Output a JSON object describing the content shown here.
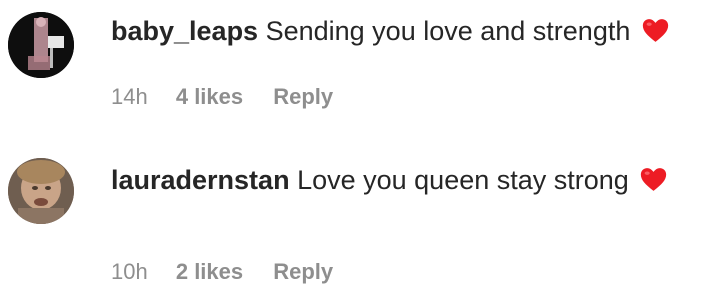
{
  "comments": [
    {
      "username": "baby_leaps",
      "text": "Sending you love and strength",
      "emoji": "heart-icon",
      "time": "14h",
      "likes": "4 likes",
      "reply_label": "Reply"
    },
    {
      "username": "laurадernstan",
      "text": "Love you queen stay strong",
      "emoji": "heart-icon",
      "time": "10h",
      "likes": "2 likes",
      "reply_label": "Reply"
    }
  ],
  "colors": {
    "text": "#262626",
    "meta": "#8e8e8e",
    "heart": "#ed1c24"
  }
}
